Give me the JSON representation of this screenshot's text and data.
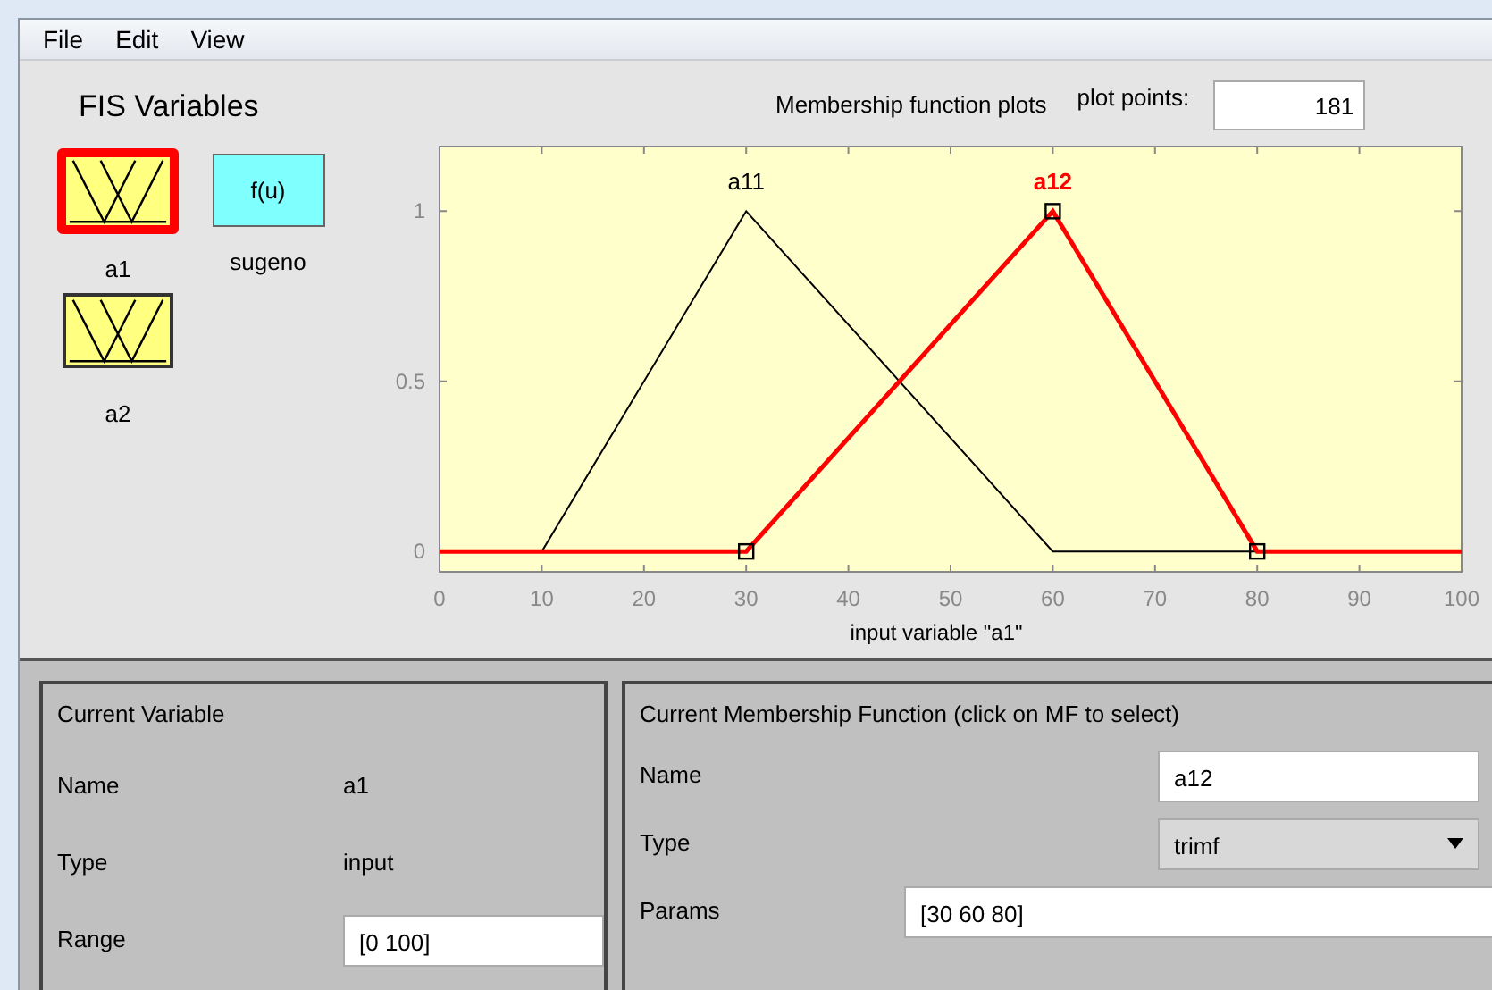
{
  "menu": [
    {
      "label": "File"
    },
    {
      "label": "Edit"
    },
    {
      "label": "View"
    }
  ],
  "fis_variables": {
    "title": "FIS Variables",
    "items": [
      {
        "label": "a1",
        "kind": "input",
        "selected": true
      },
      {
        "label": "sugeno",
        "kind": "output",
        "icon_text": "f(u)",
        "selected": false
      },
      {
        "label": "a2",
        "kind": "input",
        "selected": false
      }
    ]
  },
  "plot": {
    "membership_functions": [
      {
        "selected": false
      },
      {
        "selected": true
      }
    ],
    "title": "Membership function plots",
    "plot_points_label": "plot points:",
    "plot_points": "181",
    "chart_data": {
      "type": "line",
      "xlabel": "input variable \"a1\"",
      "x": [
        0,
        10,
        30,
        60,
        80,
        100
      ],
      "series": [
        {
          "name": "a11",
          "color": "#000000",
          "values": [
            0,
            0,
            1,
            0,
            0,
            0
          ]
        },
        {
          "name": "a12",
          "color": "#ff0000",
          "values": [
            0,
            0,
            0,
            1,
            0,
            0
          ]
        }
      ],
      "xlim": [
        0,
        100
      ],
      "ylim": [
        -0.06,
        1.19
      ],
      "xticks": [
        0,
        10,
        20,
        30,
        40,
        50,
        60,
        70,
        80,
        90,
        100
      ],
      "yticks": [
        0,
        0.5,
        1
      ]
    }
  },
  "current_variable": {
    "title": "Current Variable",
    "fields": [
      {
        "label": "Name",
        "value": "a1",
        "kind": "text"
      },
      {
        "label": "Type",
        "value": "input",
        "kind": "text"
      },
      {
        "label": "Range",
        "value": "[0 100]",
        "kind": "input"
      }
    ]
  },
  "current_mf": {
    "title": "Current Membership Function (click on MF to select)",
    "fields": [
      {
        "label": "Name",
        "value": "a12",
        "kind": "input"
      },
      {
        "label": "Type",
        "value": "trimf",
        "kind": "dropdown"
      },
      {
        "label": "Params",
        "value": "[30 60 80]",
        "kind": "input"
      }
    ]
  }
}
